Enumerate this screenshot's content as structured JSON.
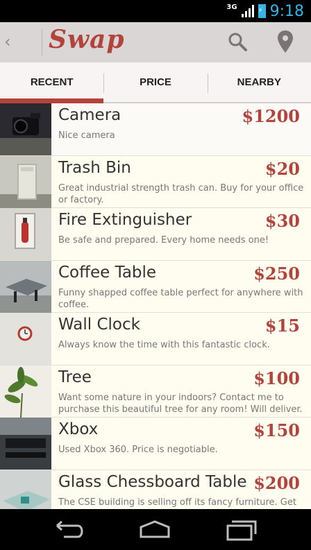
{
  "status_bar": {
    "network": "3G",
    "time": "9:18"
  },
  "action_bar": {
    "back_glyph": "‹",
    "title": "Swap",
    "icons": [
      "search-icon",
      "location-pin-icon"
    ]
  },
  "tabs": [
    {
      "label": "RECENT",
      "active": true
    },
    {
      "label": "PRICE",
      "active": false
    },
    {
      "label": "NEARBY",
      "active": false
    }
  ],
  "items": [
    {
      "title": "Camera",
      "price": "$1200",
      "description": "Nice camera"
    },
    {
      "title": "Trash Bin",
      "price": "$20",
      "description": "Great industrial strength trash can. Buy for your office or factory."
    },
    {
      "title": "Fire Extinguisher",
      "price": "$30",
      "description": "Be safe and prepared. Every home needs one!"
    },
    {
      "title": "Coffee Table",
      "price": "$250",
      "description": "Funny shapped coffee table perfect for anywhere with coffee."
    },
    {
      "title": "Wall Clock",
      "price": "$15",
      "description": "Always know the time with this fantastic clock."
    },
    {
      "title": "Tree",
      "price": "$100",
      "description": "Want some nature in your indoors? Contact me to purchase this beautiful tree for any room! Will deliver."
    },
    {
      "title": "Xbox",
      "price": "$150",
      "description": "Used Xbox 360. Price is negotiable."
    },
    {
      "title": "Glass Chessboard Table",
      "price": "$200",
      "description": "The CSE building is selling off its fancy furniture. Get"
    }
  ],
  "colors": {
    "accent": "#b2443c",
    "status_blue": "#33b5e5"
  },
  "nav_bar": {
    "icons": [
      "back-icon",
      "home-icon",
      "recent-apps-icon"
    ]
  }
}
